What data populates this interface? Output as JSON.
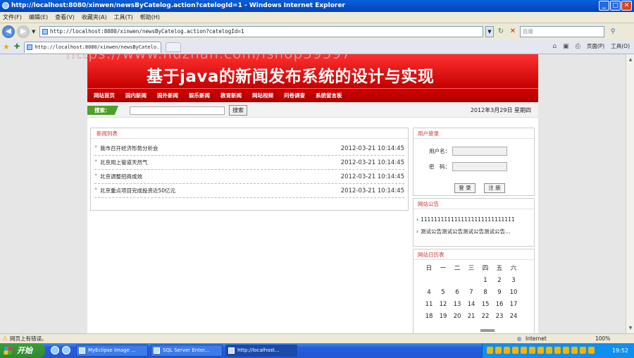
{
  "window": {
    "title": "http://localhost:8080/xinwen/newsByCatelog.action?catelogId=1 - Windows Internet Explorer",
    "min": "_",
    "max": "□",
    "close": "✕"
  },
  "menu": [
    "文件(F)",
    "编辑(E)",
    "查看(V)",
    "收藏夹(A)",
    "工具(T)",
    "帮助(H)"
  ],
  "address": {
    "url": "http://localhost:8080/xinwen/newsByCatelog.action?catelogId=1",
    "search_placeholder": "百度"
  },
  "tab": {
    "label": "http://localhost:8080/xinwen/newsByCatelo..."
  },
  "commandbar": {
    "page": "页面(P)",
    "tools": "工具(O)"
  },
  "watermark": "https://www.huzhan.com/ishop39397",
  "site": {
    "title": "基于java的新闻发布系统的设计与实现",
    "nav": [
      "网站首页",
      "国内新闻",
      "国外新闻",
      "娱乐新闻",
      "教育新闻",
      "网站视频",
      "问卷调查",
      "系统留言板"
    ],
    "search_label": "搜索：",
    "search_button": "搜索",
    "date": "2012年3月29日 星期四"
  },
  "news": {
    "heading": "新闻列表",
    "items": [
      {
        "title": "我市召开经济形势分析会",
        "date": "2012-03-21 10:14:45"
      },
      {
        "title": "北京用上管道天然气",
        "date": "2012-03-21 10:14:45"
      },
      {
        "title": "北京调整招商成效",
        "date": "2012-03-21 10:14:45"
      },
      {
        "title": "北京重点项目完成投资近50亿元",
        "date": "2012-03-21 10:14:45"
      }
    ]
  },
  "login": {
    "heading": "用户登录",
    "username_label": "用户名：",
    "password_label": "密　码：",
    "login_button": "登 录",
    "register_button": "注 册"
  },
  "notice": {
    "heading": "网站公告",
    "items": [
      "1111111111111111111111111111",
      "测试公告测试公告测试公告测试公告…"
    ]
  },
  "calendar": {
    "heading": "网站日历表",
    "weekdays": [
      "日",
      "一",
      "二",
      "三",
      "四",
      "五",
      "六"
    ],
    "days": [
      "",
      "",
      "",
      "",
      "1",
      "2",
      "3",
      "4",
      "5",
      "6",
      "7",
      "8",
      "9",
      "10",
      "11",
      "12",
      "13",
      "14",
      "15",
      "16",
      "17",
      "18",
      "19",
      "20",
      "21",
      "22",
      "23",
      "24"
    ]
  },
  "status": {
    "message": "网页上有错误。",
    "zone": "Internet",
    "zoom": "100%"
  },
  "taskbar": {
    "start": "开始",
    "items": [
      "MyEclipse Image ...",
      "SQL Server Enter...",
      "http://localhost..."
    ],
    "clock": "19:52"
  }
}
